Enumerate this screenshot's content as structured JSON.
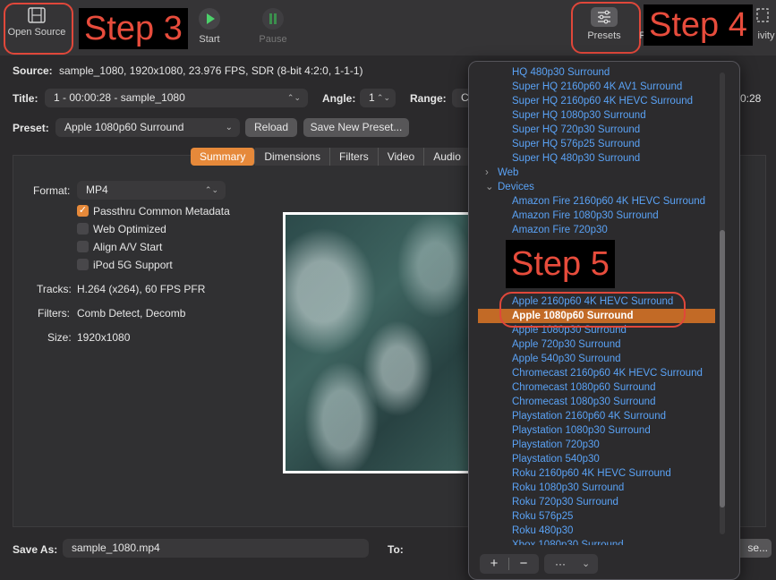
{
  "toolbar": {
    "open_source": "Open Source",
    "start": "Start",
    "pause": "Pause",
    "presets": "Presets",
    "activity_fragment": "ivity",
    "p_fragment": "P"
  },
  "steps": {
    "step3": "Step 3",
    "step4": "Step 4",
    "step5": "Step 5"
  },
  "source": {
    "label": "Source:",
    "value": "sample_1080, 1920x1080, 23.976 FPS, SDR (8-bit 4:2:0, 1-1-1)"
  },
  "title_row": {
    "title_label": "Title:",
    "title_value": "1 - 00:00:28 - sample_1080",
    "angle_label": "Angle:",
    "angle_value": "1",
    "range_label": "Range:",
    "range_value": "Cl",
    "time_fragment": "0:28"
  },
  "preset_row": {
    "label": "Preset:",
    "value": "Apple 1080p60 Surround",
    "reload": "Reload",
    "save_new": "Save New Preset..."
  },
  "tabs": [
    "Summary",
    "Dimensions",
    "Filters",
    "Video",
    "Audio"
  ],
  "summary": {
    "format_label": "Format:",
    "format_value": "MP4",
    "checkboxes": [
      {
        "label": "Passthru Common Metadata",
        "checked": true
      },
      {
        "label": "Web Optimized",
        "checked": false
      },
      {
        "label": "Align A/V Start",
        "checked": false
      },
      {
        "label": "iPod 5G Support",
        "checked": false
      }
    ],
    "tracks_label": "Tracks:",
    "tracks_value": "H.264 (x264), 60 FPS PFR",
    "filters_label": "Filters:",
    "filters_value": "Comb Detect, Decomb",
    "size_label": "Size:",
    "size_value": "1920x1080"
  },
  "save": {
    "label": "Save As:",
    "value": "sample_1080.mp4",
    "to_label": "To:",
    "browse_fragment": "se..."
  },
  "presets_popover": {
    "items": [
      "HQ 480p30 Surround",
      "Super HQ 2160p60 4K AV1 Surround",
      "Super HQ 2160p60 4K HEVC Surround",
      "Super HQ 1080p30 Surround",
      "Super HQ 720p30 Surround",
      "Super HQ 576p25 Surround",
      "Super HQ 480p30 Surround"
    ],
    "group_web": "Web",
    "group_devices": "Devices",
    "devices_top": [
      "Amazon Fire 2160p60 4K HEVC Surround",
      "Amazon Fire 1080p30 Surround",
      "Amazon Fire 720p30"
    ],
    "devices_bottom": [
      "Apple 2160p60 4K HEVC Surround",
      "Apple 1080p60 Surround",
      "Apple 1080p30 Surround",
      "Apple 720p30 Surround",
      "Apple 540p30 Surround",
      "Chromecast 2160p60 4K HEVC Surround",
      "Chromecast 1080p60 Surround",
      "Chromecast 1080p30 Surround",
      "Playstation 2160p60 4K Surround",
      "Playstation 1080p30 Surround",
      "Playstation 720p30",
      "Playstation 540p30",
      "Roku 2160p60 4K HEVC Surround",
      "Roku 1080p30 Surround",
      "Roku 720p30 Surround",
      "Roku 576p25",
      "Roku 480p30",
      "Xbox 1080p30 Surround"
    ],
    "selected": "Apple 1080p60 Surround",
    "add": "+",
    "remove": "−",
    "more": "···"
  },
  "colors": {
    "accent": "#e6893a",
    "link": "#5aa2f5",
    "selected_row": "#c26a26",
    "annotation": "#e0473a"
  }
}
